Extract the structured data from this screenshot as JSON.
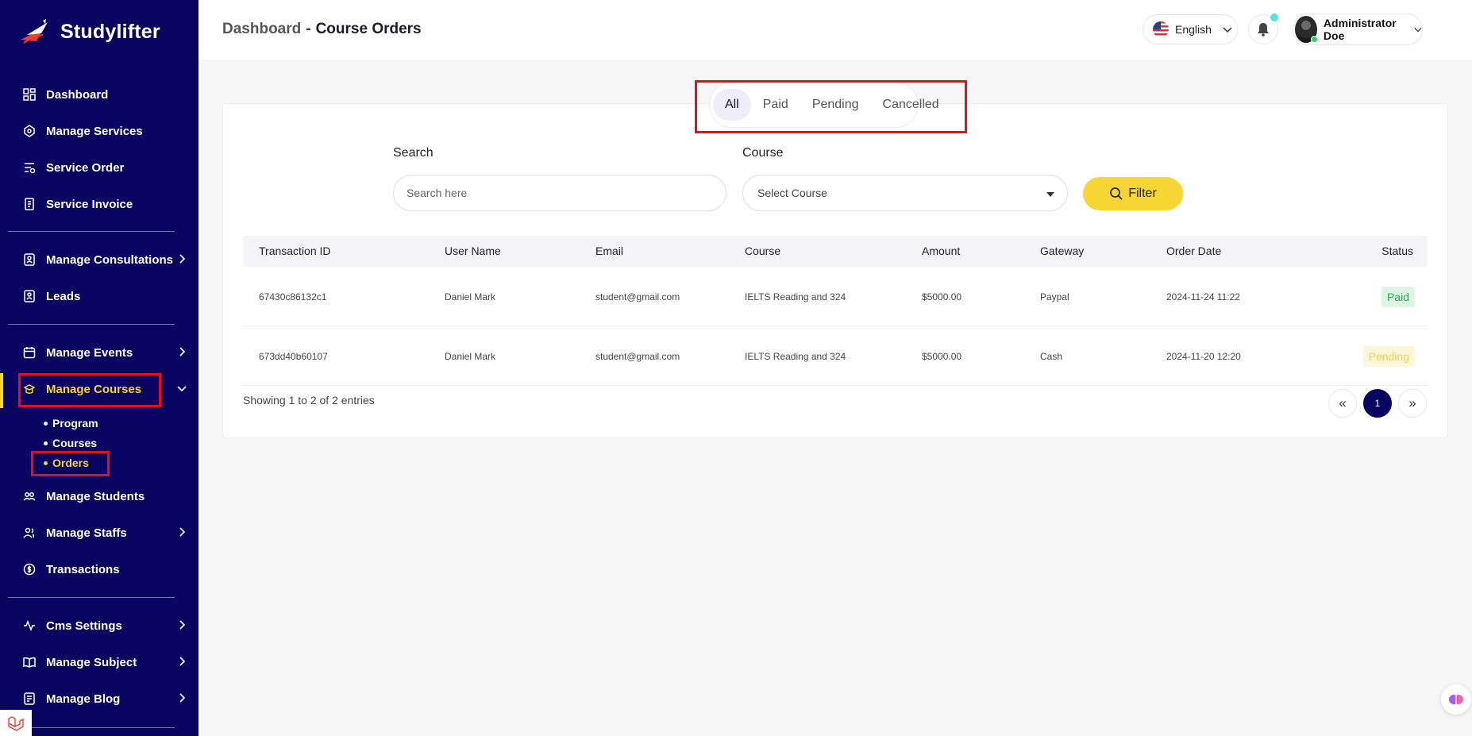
{
  "brand": {
    "name": "Studylifter"
  },
  "sidebar": {
    "items": [
      {
        "label": "Dashboard",
        "icon": "dashboard-icon"
      },
      {
        "label": "Manage Services",
        "icon": "services-icon"
      },
      {
        "label": "Service Order",
        "icon": "order-icon"
      },
      {
        "label": "Service Invoice",
        "icon": "invoice-icon"
      },
      {
        "label": "Manage Consultations",
        "icon": "consultation-icon"
      },
      {
        "label": "Leads",
        "icon": "leads-icon"
      },
      {
        "label": "Manage Events",
        "icon": "calendar-icon"
      },
      {
        "label": "Manage Courses",
        "icon": "courses-icon"
      },
      {
        "label": "Manage Students",
        "icon": "students-icon"
      },
      {
        "label": "Manage Staffs",
        "icon": "staff-icon"
      },
      {
        "label": "Transactions",
        "icon": "transactions-icon"
      },
      {
        "label": "Cms Settings",
        "icon": "cms-icon"
      },
      {
        "label": "Manage Subject",
        "icon": "book-icon"
      },
      {
        "label": "Manage Blog",
        "icon": "blog-icon"
      }
    ],
    "sub_items": [
      {
        "label": "Program"
      },
      {
        "label": "Courses"
      },
      {
        "label": "Orders"
      }
    ]
  },
  "header": {
    "breadcrumb_root": "Dashboard",
    "breadcrumb_sep": "-",
    "breadcrumb_current": "Course Orders",
    "language": "English",
    "user_name": "Administrator Doe"
  },
  "tabs": [
    {
      "label": "All"
    },
    {
      "label": "Paid"
    },
    {
      "label": "Pending"
    },
    {
      "label": "Cancelled"
    }
  ],
  "filters": {
    "search_label": "Search",
    "search_placeholder": "Search here",
    "course_label": "Course",
    "course_placeholder": "Select Course",
    "filter_button": "Filter"
  },
  "table": {
    "columns": [
      "Transaction ID",
      "User Name",
      "Email",
      "Course",
      "Amount",
      "Gateway",
      "Order Date",
      "Status"
    ],
    "rows": [
      {
        "transaction_id": "67430c86132c1",
        "user_name": "Daniel Mark",
        "email": "student@gmail.com",
        "course": "IELTS Reading and 324",
        "amount": "$5000.00",
        "gateway": "Paypal",
        "order_date": "2024-11-24 11:22",
        "status": "Paid"
      },
      {
        "transaction_id": "673dd40b60107",
        "user_name": "Daniel Mark",
        "email": "student@gmail.com",
        "course": "IELTS Reading and 324",
        "amount": "$5000.00",
        "gateway": "Cash",
        "order_date": "2024-11-20 12:20",
        "status": "Pending"
      }
    ]
  },
  "pagination": {
    "summary": "Showing 1 to 2 of 2 entries",
    "prev": "«",
    "current": "1",
    "next": "»"
  },
  "colors": {
    "sidebar_bg": "#09045f",
    "accent_yellow": "#f6d534",
    "highlight_red": "#e3101b",
    "paid_green": "#1fae4a",
    "pending_yellow": "#f2d04a"
  }
}
